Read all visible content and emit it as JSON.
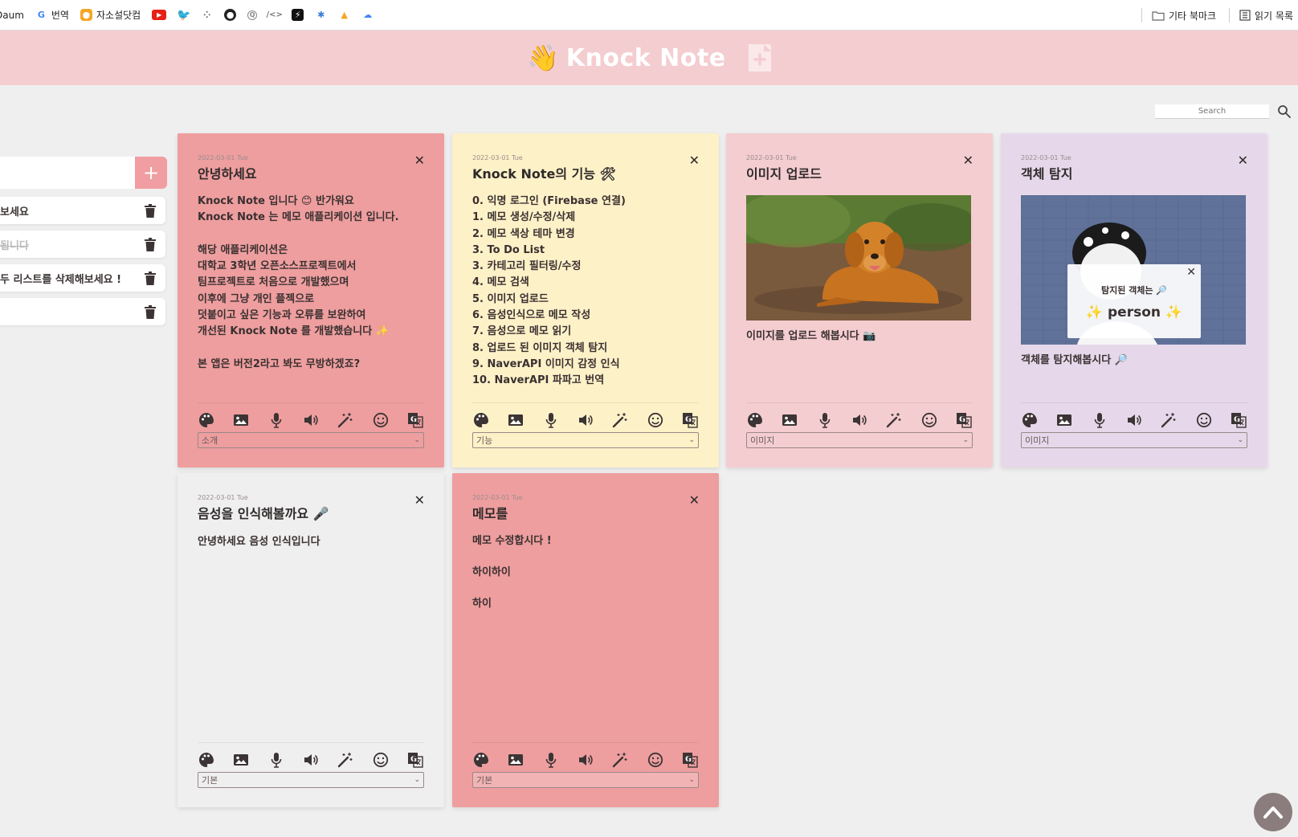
{
  "bookmarks": {
    "items": [
      {
        "icon": "daum-icon",
        "label": "Daum"
      },
      {
        "icon": "google-translate-icon",
        "label": "번역"
      },
      {
        "icon": "jasoseol-icon",
        "label": "자소설닷컴"
      }
    ],
    "right": [
      {
        "icon": "folder-icon",
        "label": "기타 북마크"
      },
      {
        "icon": "reading-list-icon",
        "label": "읽기 목록"
      }
    ]
  },
  "header": {
    "title": "Knock Note",
    "emoji": "👋"
  },
  "search": {
    "placeholder": "Search"
  },
  "todo": {
    "add_symbol": "+",
    "items": [
      {
        "text": "보세요",
        "done": false
      },
      {
        "text": "됩니다",
        "done": true
      },
      {
        "text": "두 리스트를 삭제해보세요 !",
        "done": false
      },
      {
        "text": "",
        "done": false
      }
    ]
  },
  "notes": [
    {
      "date": "2022-03-01 Tue",
      "title": "안녕하세요",
      "body": "Knock Note 입니다 😊 반가워요\nKnock Note 는 메모 애플리케이션 입니다.\n\n해당 애플리케이션은\n대학교 3학년 오픈소스프로젝트에서\n팀프로젝트로 처음으로 개발했으며\n이후에 그냥 개인 플젝으로\n덧붙이고 싶은 기능과 오류를 보완하여\n개선된 Knock Note 를 개발했습니다 ✨\n\n본 앱은 버전2라고 봐도 무방하겠죠?",
      "category": "소개",
      "color": "#ee9e9f"
    },
    {
      "date": "2022-03-01 Tue",
      "title": "Knock Note의 기능 🛠",
      "body": "0. 익명 로그인 (Firebase 연결)\n1. 메모 생성/수정/삭제\n2. 메모 색상 테마 변경\n3. To Do List\n3. 카테고리 필터링/수정\n4. 메모 검색\n5. 이미지 업로드\n6. 음성인식으로 메모 작성\n7. 음성으로 메모 읽기\n8. 업로드 된 이미지 객체 탐지\n9. NaverAPI 이미지 감정 인식\n10. NaverAPI 파파고 번역",
      "category": "기능",
      "color": "#fdf1c8"
    },
    {
      "date": "2022-03-01 Tue",
      "title": "이미지 업로드",
      "caption": "이미지를 업로드 해봅시다 📷",
      "category": "이미지",
      "color": "#f4cdd0"
    },
    {
      "date": "2022-03-01 Tue",
      "title": "객체 탐지",
      "caption": "객체를 탐지해봅시다 🔎",
      "popup_label": "탐지된 객체는 🔎",
      "popup_object": "✨ person ✨",
      "category": "이미지",
      "color": "#e6d8ea"
    },
    {
      "date": "2022-03-01 Tue",
      "title": "음성을 인식해볼까요 🎤",
      "body": "안녕하세요 음성 인식입니다",
      "category": "기본",
      "color": "#efefef"
    },
    {
      "date": "2022-03-01 Tue",
      "title": "메모를",
      "body": "메모 수정합시다 !\n\n하이하이\n\n하이",
      "category": "기본",
      "color": "#ee9e9f"
    }
  ],
  "close_symbol": "✕",
  "toolbar_icons": [
    "palette-icon",
    "image-icon",
    "microphone-icon",
    "speaker-icon",
    "magic-wand-icon",
    "emoji-icon",
    "translate-icon"
  ]
}
